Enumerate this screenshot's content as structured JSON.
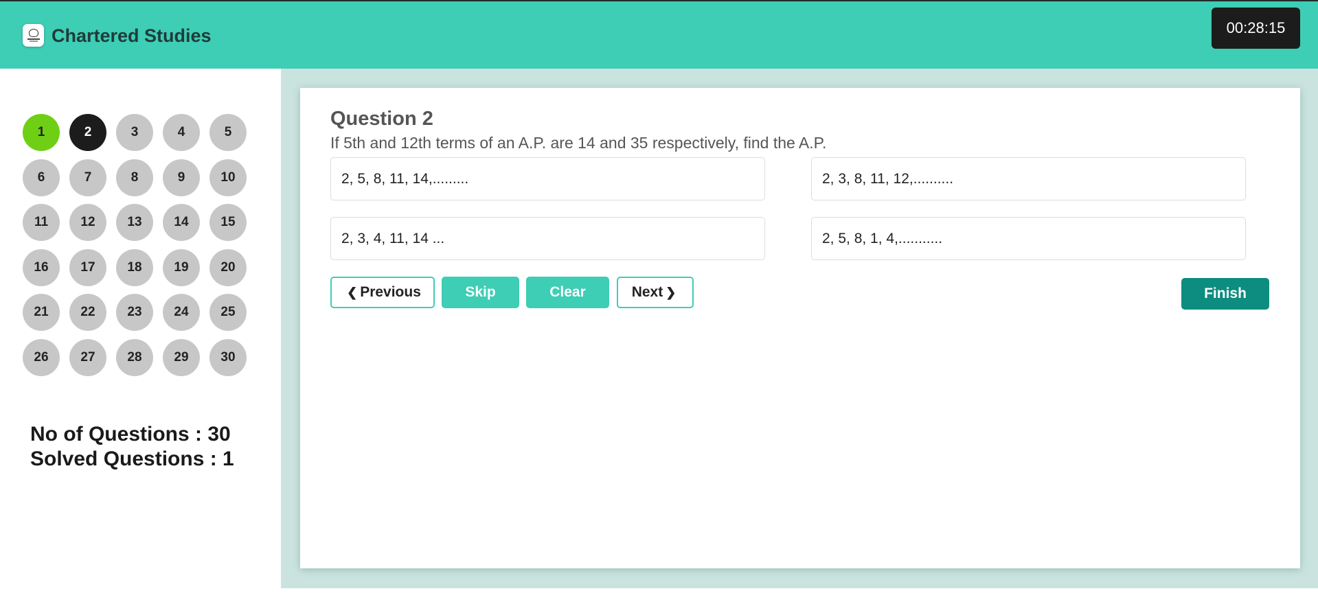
{
  "header": {
    "brand": "Chartered Studies",
    "timer": "00:28:15",
    "logo_icon": "chartered-studies-logo-icon"
  },
  "sidebar": {
    "questions": [
      "1",
      "2",
      "3",
      "4",
      "5",
      "6",
      "7",
      "8",
      "9",
      "10",
      "11",
      "12",
      "13",
      "14",
      "15",
      "16",
      "17",
      "18",
      "19",
      "20",
      "21",
      "22",
      "23",
      "24",
      "25",
      "26",
      "27",
      "28",
      "29",
      "30"
    ],
    "answered": [
      "1"
    ],
    "current": "2",
    "total_label": "No of Questions : 30",
    "solved_label": "Solved Questions : 1"
  },
  "question": {
    "title": "Question 2",
    "text": "If 5th and 12th terms of an A.P. are 14 and 35 respectively, find the A.P.",
    "options": [
      "2, 5, 8, 11, 14,.........",
      "2, 3, 8, 11, 12,..........",
      "2, 3, 4, 11, 14 ...",
      "2, 5, 8, 1, 4,..........."
    ]
  },
  "controls": {
    "previous": "Previous",
    "skip": "Skip",
    "clear": "Clear",
    "next": "Next",
    "finish": "Finish"
  },
  "colors": {
    "header": "#3ecdb5",
    "answered": "#6fcf14",
    "current": "#1c1c1c",
    "unanswered": "#c7c7c7",
    "finish": "#0d8c80",
    "panel_bg": "#cae3df"
  }
}
